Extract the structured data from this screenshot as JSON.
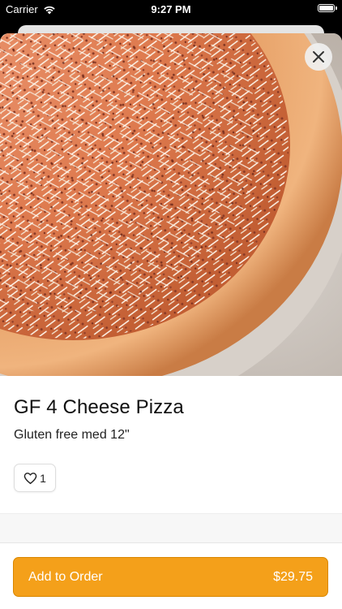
{
  "status_bar": {
    "carrier": "Carrier",
    "time": "9:27 PM",
    "battery_level": 1.0
  },
  "item": {
    "image_description": "gluten-free four cheese pizza",
    "title": "GF 4 Cheese Pizza",
    "description": "Gluten free med 12\"",
    "likes": "1"
  },
  "icons": {
    "close": "close-icon",
    "heart": "heart-icon",
    "wifi": "wifi-icon",
    "battery": "battery-icon"
  },
  "footer": {
    "add_label": "Add to Order",
    "price": "$29.75"
  },
  "colors": {
    "accent": "#f4a01a",
    "accent_border": "#d98700"
  }
}
